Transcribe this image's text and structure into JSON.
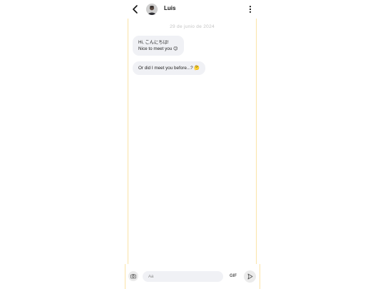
{
  "header": {
    "contact_name": "Luis",
    "back_icon": "chevron-left-icon",
    "menu_icon": "more-vertical-icon"
  },
  "chat": {
    "date": "29 de junio de 2024",
    "messages": [
      {
        "lines": [
          "Hi, こんにちは!",
          "Nice to meet you 😉"
        ]
      },
      {
        "lines": [
          "Or did I meet you before...? 🤔"
        ]
      }
    ]
  },
  "composer": {
    "placeholder": "Aa",
    "gif_label": "GIF",
    "camera_icon": "camera-icon",
    "send_icon": "send-icon"
  },
  "colors": {
    "border_accent": "#fbe3a6",
    "bubble_bg": "#f0f1f5",
    "date_text": "#c4c4c4"
  }
}
